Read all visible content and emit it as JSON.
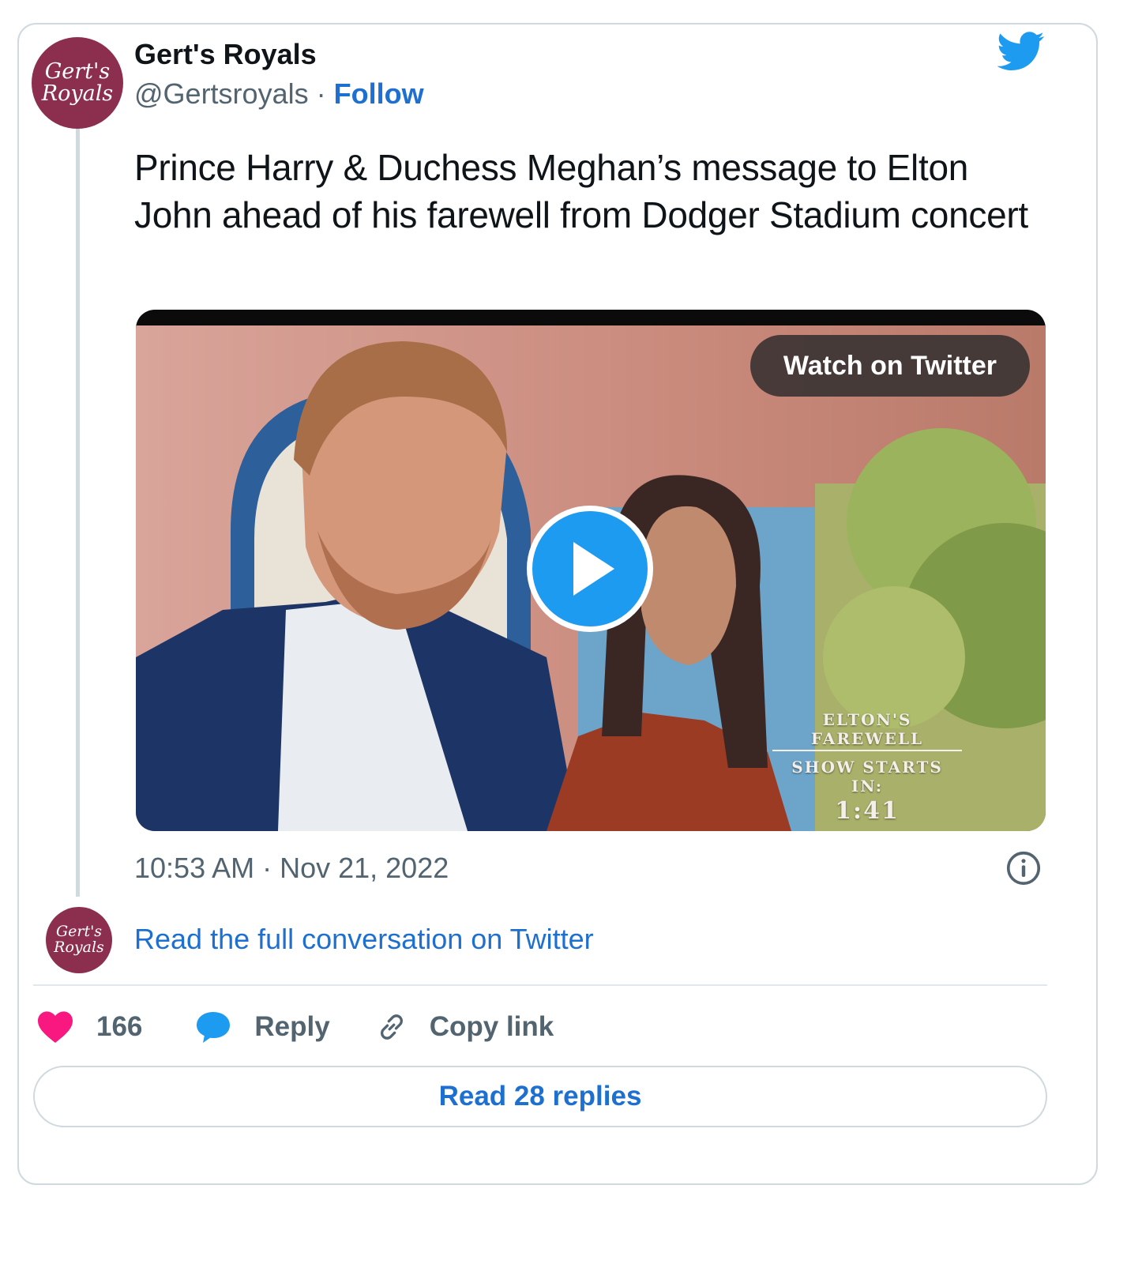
{
  "author": {
    "avatar_text_line1": "Gert's",
    "avatar_text_line2": "Royals",
    "name": "Gert's Royals",
    "handle": "@Gertsroyals",
    "separator": " · ",
    "follow_label": "Follow"
  },
  "tweet": {
    "text": "Prince Harry & Duchess Meghan’s message to Elton John ahead of his farewell from Dodger Stadium concert",
    "timestamp": "10:53 AM · Nov 21, 2022"
  },
  "media": {
    "watch_label": "Watch on Twitter",
    "overlay_line1": "ELTON'S FAREWELL",
    "overlay_line2": "SHOW STARTS IN:",
    "overlay_line3": "1:41"
  },
  "conversation": {
    "link_label": "Read the full conversation on Twitter"
  },
  "actions": {
    "like_count": "166",
    "reply_label": "Reply",
    "copy_label": "Copy link"
  },
  "replies": {
    "label": "Read 28 replies"
  },
  "colors": {
    "accent": "#1d9bf0",
    "link": "#1d70d0",
    "like": "#f91880",
    "avatar": "#8c2f4e",
    "muted": "#536471"
  }
}
